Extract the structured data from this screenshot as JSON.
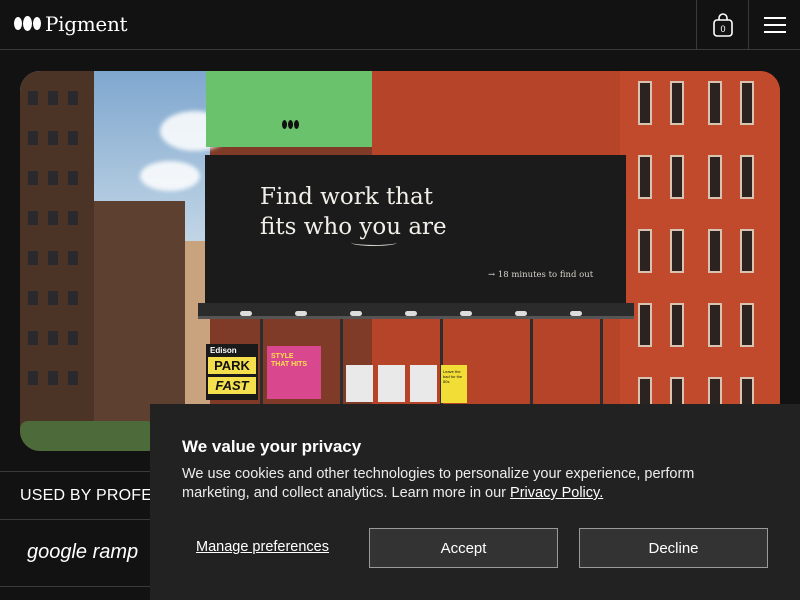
{
  "header": {
    "brand": "Pigment",
    "cart_count": "0"
  },
  "hero": {
    "billboard_line1": "Find work that",
    "billboard_line2": "fits who you are",
    "billboard_sub": "→ 18 minutes to find out",
    "poster_park_top": "Edison",
    "poster_park_mid": "PARK",
    "poster_park_bottom": "FAST",
    "poster_style_line1": "STYLE",
    "poster_style_line2": "THAT HITS",
    "poster_yellow_text": "Leave the bad for the 80s"
  },
  "used_by": {
    "label": "USED BY PROFES"
  },
  "logos": {
    "text": "google ramp"
  },
  "cookie": {
    "title": "We value your privacy",
    "body": "We use cookies and other technologies to personalize your experience, perform marketing, and collect analytics. Learn more in our ",
    "link": "Privacy Policy.",
    "manage": "Manage preferences",
    "accept": "Accept",
    "decline": "Decline"
  },
  "icons": {
    "cart": "shopping-bag-icon",
    "menu": "hamburger-menu-icon",
    "logo": "pigment-logo-mark"
  }
}
